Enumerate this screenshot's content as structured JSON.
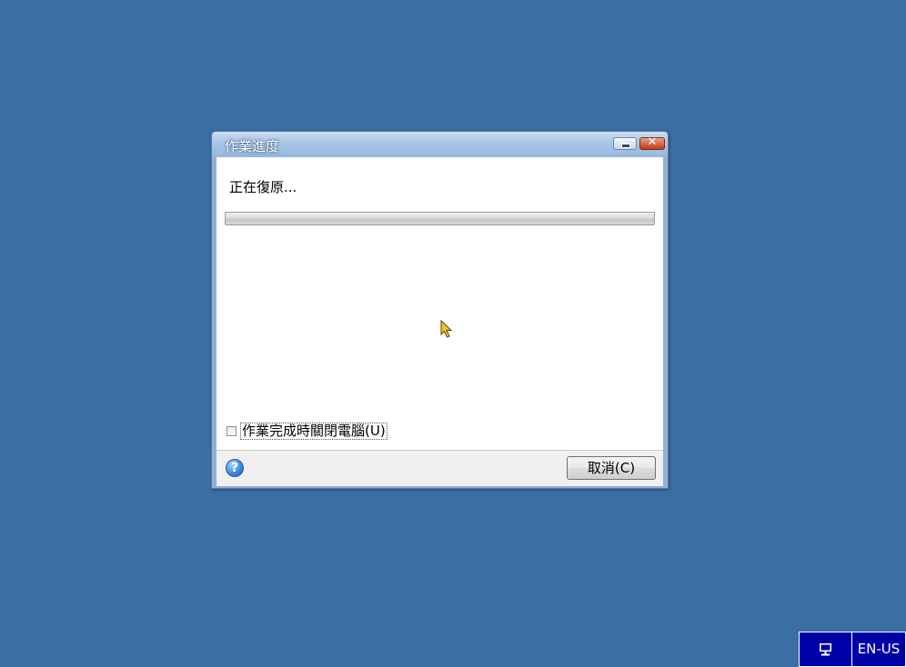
{
  "dialog": {
    "title": "作業進度",
    "status_text": "正在復原...",
    "progress": 0,
    "shutdown_checkbox": {
      "label": "作業完成時關閉電腦(U)",
      "checked": false
    },
    "cancel_label": "取消(C)",
    "help_icon": "question-mark-icon",
    "help_glyph": "?"
  },
  "tray": {
    "network_icon": "network-icon",
    "language": "EN-US"
  },
  "colors": {
    "desktop": "#3b6ea5",
    "tray": "#0000a8"
  }
}
